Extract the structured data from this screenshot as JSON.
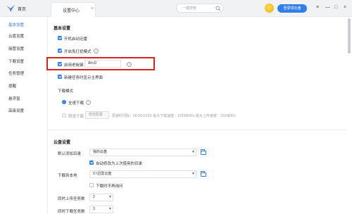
{
  "topbar": {
    "home_label": "首页",
    "tab_title": "设置中心",
    "tab_close": "×",
    "search_placeholder": "一键搜索",
    "login_button": "登录领云盘",
    "window_controls": [
      "≡",
      "—",
      "□",
      "×"
    ]
  },
  "sidebar": {
    "items": [
      {
        "label": "基本设置",
        "active": true
      },
      {
        "label": "云盘设置",
        "active": false
      },
      {
        "label": "接管设置",
        "active": false
      },
      {
        "label": "下载设置",
        "active": false
      },
      {
        "label": "任务管理",
        "active": false
      },
      {
        "label": "提醒",
        "active": false
      },
      {
        "label": "悬浮窗",
        "active": false
      },
      {
        "label": "高级设置",
        "active": false
      }
    ]
  },
  "basic": {
    "title": "基本设置",
    "autostart": "开机启动迅雷",
    "free_mode": "开启免打扰模式",
    "hotkey_label": "启用老板键",
    "hotkey_value": "Alt+D",
    "new_task_show": "新建任务时显示主界面",
    "download_mode_title": "下载模式",
    "full_speed": "全速下载",
    "limited": "限速下载",
    "modify_config": "修改配置",
    "limit_info": "限速时间段：00:00-23:59  最大下载速度：10240KB/s  最大上传速度：1024KB/s"
  },
  "cloud": {
    "title": "云盘设置",
    "default_dir_label": "默认添加目录",
    "default_dir_value": "我的云盘",
    "auto_last_dir": "自动修改为上次使用的目录",
    "download_to_label": "下载到本地",
    "download_to_value": "D:\\迅雷云盘",
    "no_ask": "下载时不再询问",
    "upload_count_label": "同时上传任务数",
    "upload_count_value": "2",
    "download_count_label": "同时下载任务数",
    "download_count_value": "3"
  },
  "colors": {
    "accent": "#2f7fe8",
    "highlight_border": "#d9261c"
  }
}
